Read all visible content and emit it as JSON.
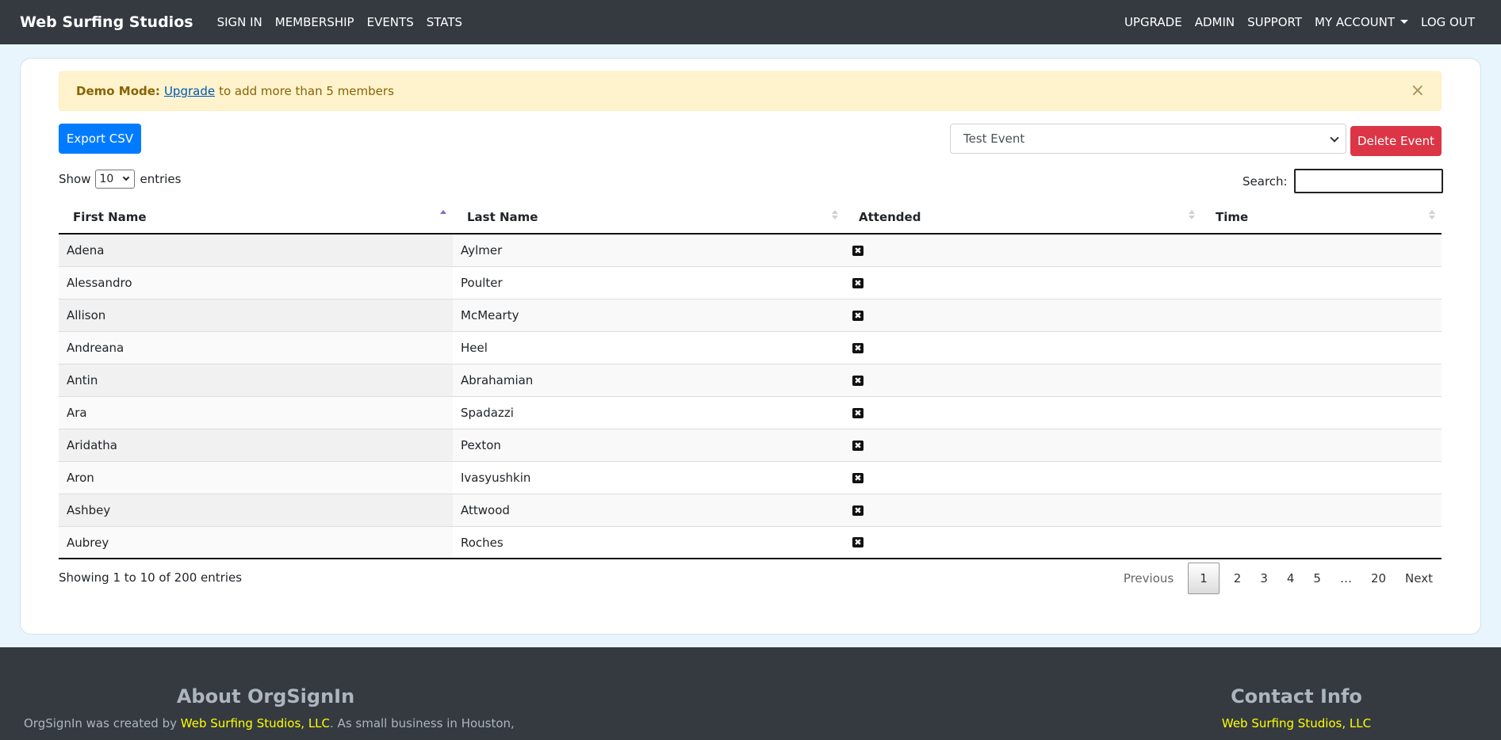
{
  "nav": {
    "brand": "Web Surfing Studios",
    "left": [
      "SIGN IN",
      "MEMBERSHIP",
      "EVENTS",
      "STATS"
    ],
    "right": [
      "UPGRADE",
      "ADMIN",
      "SUPPORT",
      "MY ACCOUNT",
      "LOG OUT"
    ]
  },
  "alert": {
    "bold": "Demo Mode:",
    "link": "Upgrade",
    "text": "to add more than 5 members",
    "close": "×"
  },
  "toolbar": {
    "export_label": "Export CSV",
    "event_selected": "Test Event",
    "delete_label": "Delete Event"
  },
  "length": {
    "show": "Show",
    "value": "10",
    "entries": "entries"
  },
  "search": {
    "label": "Search:",
    "value": ""
  },
  "table": {
    "columns": [
      "First Name",
      "Last Name",
      "Attended",
      "Time"
    ],
    "sorted_column": "First Name",
    "rows": [
      {
        "first": "Adena",
        "last": "Aylmer",
        "attended": "✖",
        "time": ""
      },
      {
        "first": "Alessandro",
        "last": "Poulter",
        "attended": "✖",
        "time": ""
      },
      {
        "first": "Allison",
        "last": "McMearty",
        "attended": "✖",
        "time": ""
      },
      {
        "first": "Andreana",
        "last": "Heel",
        "attended": "✖",
        "time": ""
      },
      {
        "first": "Antin",
        "last": "Abrahamian",
        "attended": "✖",
        "time": ""
      },
      {
        "first": "Ara",
        "last": "Spadazzi",
        "attended": "✖",
        "time": ""
      },
      {
        "first": "Aridatha",
        "last": "Pexton",
        "attended": "✖",
        "time": ""
      },
      {
        "first": "Aron",
        "last": "Ivasyushkin",
        "attended": "✖",
        "time": ""
      },
      {
        "first": "Ashbey",
        "last": "Attwood",
        "attended": "✖",
        "time": ""
      },
      {
        "first": "Aubrey",
        "last": "Roches",
        "attended": "✖",
        "time": ""
      }
    ]
  },
  "info": "Showing 1 to 10 of 200 entries",
  "pagination": {
    "previous": "Previous",
    "pages": [
      "1",
      "2",
      "3",
      "4",
      "5",
      "…",
      "20"
    ],
    "current": "1",
    "next": "Next"
  },
  "footer": {
    "about_title": "About OrgSignIn",
    "about_prefix": "OrgSignIn was created by",
    "about_link": "Web Surfing Studios, LLC",
    "about_suffix": ". As small business in Houston,",
    "contact_title": "Contact Info",
    "contact_link": "Web Surfing Studios, LLC"
  },
  "colors": {
    "navbar": "#343a40",
    "primary": "#007bff",
    "danger": "#dc3545",
    "alert_bg": "#fff3cd",
    "footer_link": "#ffff00"
  }
}
